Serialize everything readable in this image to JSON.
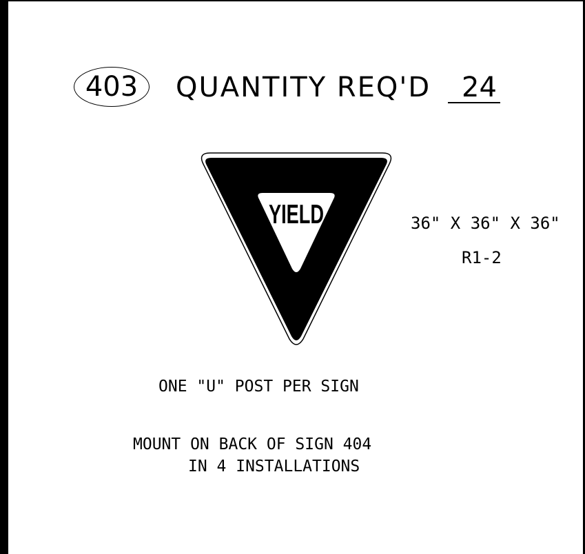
{
  "sheet": {
    "sign_number": "403",
    "quantity_label": "QUANTITY REQ'D",
    "quantity_value": "24"
  },
  "sign": {
    "legend": "YIELD",
    "size": "36\" X 36\" X 36\"",
    "code": "R1-2",
    "colors": {
      "border": "#000000",
      "background": "#ffffff",
      "panel": "#000000"
    }
  },
  "notes": {
    "post": "ONE \"U\" POST PER SIGN",
    "mount": "MOUNT ON BACK OF SIGN  404",
    "installations": "IN 4 INSTALLATIONS"
  }
}
